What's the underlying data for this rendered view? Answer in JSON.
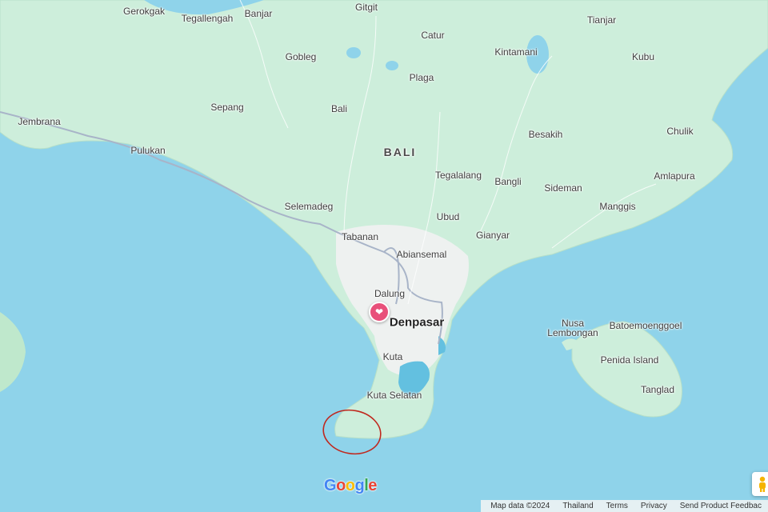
{
  "labels": {
    "gerokgak": "Gerokgak",
    "tegallengah": "Tegallengah",
    "banjar": "Banjar",
    "gitgit": "Gitgit",
    "tianjar": "Tianjar",
    "catur": "Catur",
    "gobleg": "Gobleg",
    "kintamani": "Kintamani",
    "kubu": "Kubu",
    "plaga": "Plaga",
    "jembrana": "Jembrana",
    "sepang": "Sepang",
    "bali_village": "Bali",
    "besakih": "Besakih",
    "chulik": "Chulik",
    "pulukan": "Pulukan",
    "bali_region": "BALI",
    "tegalalang": "Tegalalang",
    "bangli": "Bangli",
    "amlapura": "Amlapura",
    "sideman": "Sideman",
    "selemadeg": "Selemadeg",
    "manggis": "Manggis",
    "ubud": "Ubud",
    "tabanan": "Tabanan",
    "gianyar": "Gianyar",
    "abiansemal": "Abiansemal",
    "dalung": "Dalung",
    "denpasar": "Denpasar",
    "nusa": "Nusa",
    "lembongan": "Lembongan",
    "batoemoenggoel": "Batoemoenggoel",
    "kuta": "Kuta",
    "penida_island": "Penida Island",
    "tanglad": "Tanglad",
    "kuta_selatan": "Kuta Selatan"
  },
  "pin": {
    "icon": "heart-icon",
    "color": "#e8507a"
  },
  "annotation": {
    "shape": "red-ellipse",
    "color": "#c0281e"
  },
  "logo": {
    "letters": [
      "G",
      "o",
      "o",
      "g",
      "l",
      "e"
    ],
    "colors": [
      "#4285f4",
      "#ea4335",
      "#fbbc05",
      "#4285f4",
      "#34a853",
      "#ea4335"
    ]
  },
  "attribution": {
    "map_data": "Map data ©2024",
    "country": "Thailand",
    "terms": "Terms",
    "privacy": "Privacy",
    "feedback": "Send Product Feedbac"
  },
  "colors": {
    "water": "#8fd3ea",
    "land": "#cfeedd",
    "urban": "#eef1f0",
    "road": "#a8b4c8"
  }
}
